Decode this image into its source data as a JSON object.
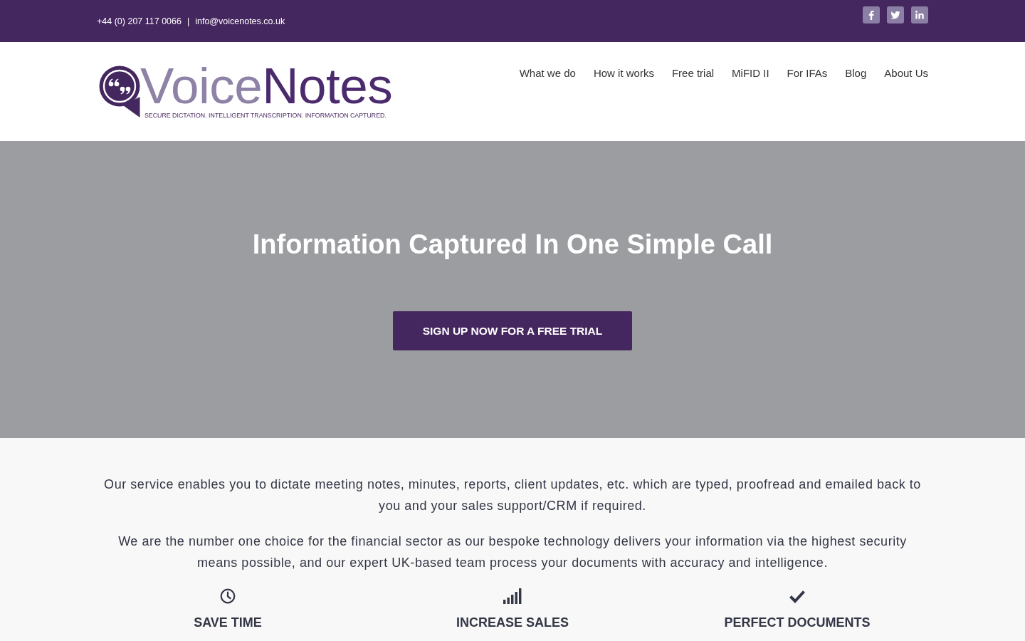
{
  "top_bar": {
    "phone": "+44 (0) 207 117 0066",
    "separator": "|",
    "email": "info@voicenotes.co.uk"
  },
  "header": {
    "logo": {
      "wordmark_light": "Voice",
      "wordmark_dark": "Notes",
      "tagline": "SECURE DICTATION. INTELLIGENT TRANSCRIPTION. INFORMATION CAPTURED."
    },
    "nav": [
      "What we do",
      "How it works",
      "Free trial",
      "MiFID II",
      "For IFAs",
      "Blog",
      "About Us"
    ]
  },
  "hero": {
    "title": "Information Captured In One Simple Call",
    "button": "SIGN UP NOW FOR A FREE TRIAL"
  },
  "intro": {
    "paragraphs": [
      "Our service enables you to dictate meeting notes, minutes, reports, client updates, etc. which are typed, proofread and emailed back to you and your sales support/CRM if required.",
      "We are the number one choice for the financial sector as our bespoke technology delivers your information via the highest security means possible, and our expert UK-based team process your documents with accuracy and intelligence."
    ]
  },
  "features": [
    {
      "title": "SAVE TIME"
    },
    {
      "title": "INCREASE SALES"
    },
    {
      "title": "PERFECT DOCUMENTS"
    }
  ]
}
